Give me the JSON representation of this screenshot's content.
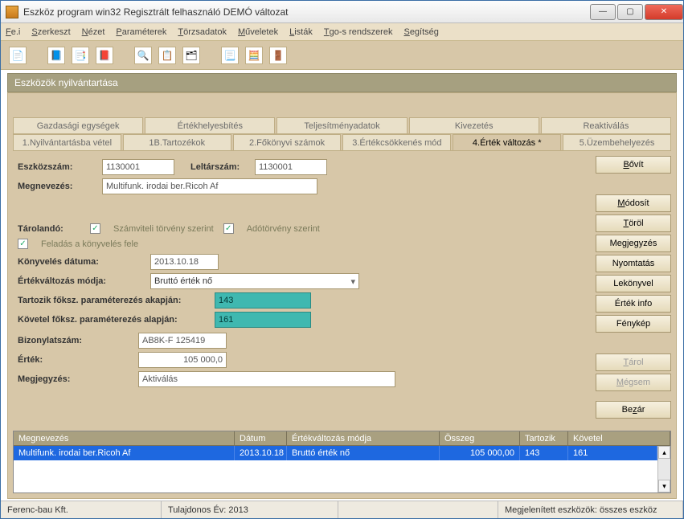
{
  "window": {
    "title": "Eszköz program win32 Regisztrált felhasználó  DEMÓ változat"
  },
  "menu": {
    "file": {
      "u": "F",
      "rest": "e.i"
    },
    "edit": {
      "u": "S",
      "rest": "zerkeszt"
    },
    "view": {
      "u": "N",
      "rest": "ézet"
    },
    "params": {
      "u": "P",
      "rest": "araméterek"
    },
    "torzs": {
      "u": "T",
      "rest": "örzsadatok"
    },
    "muv": {
      "u": "M",
      "rest": "űveletek"
    },
    "list": {
      "u": "L",
      "rest": "isták"
    },
    "tgo": {
      "u": "T",
      "rest": "go-s rendszerek"
    },
    "help": {
      "u": "S",
      "rest": "egítség"
    }
  },
  "panel_title": "Eszközök nyilvántartása",
  "tabs1": {
    "t0": "Gazdasági egységek",
    "t1": "Értékhelyesbítés",
    "t2": "Teljesítményadatok",
    "t3": "Kivezetés",
    "t4": "Reaktiválás"
  },
  "tabs2": {
    "t0": "1.Nyilvántartásba vétel",
    "t1": "1B.Tartozékok",
    "t2": "2.Főkönyvi számok",
    "t3": "3.Értékcsökkenés mód",
    "t4": "4.Érték változás *",
    "t5": "5.Üzembehelyezés"
  },
  "form": {
    "eszkozszam_lbl": "Eszközszám:",
    "eszkozszam_val": "1130001",
    "leltarszam_lbl": "Leltárszám:",
    "leltarszam_val": "1130001",
    "megnevezes_lbl": "Megnevezés:",
    "megnevezes_val": "Multifunk. irodai ber.Ricoh Af",
    "tarolando_lbl": "Tárolandó:",
    "cb_szamv": "Számviteli törvény szerint",
    "cb_ado": "Adótörvény szerint",
    "cb_feladas": "Feladás a könyvelés fele",
    "konyv_lbl": "Könyvelés dátuma:",
    "konyv_val": "2013.10.18",
    "ertekvalt_lbl": "Értékváltozás módja:",
    "ertekvalt_val": "Bruttó érték nő",
    "tartozik_lbl": "Tartozik főksz. paraméterezés akapján:",
    "tartozik_val": "143",
    "kovetel_lbl": "Követel főksz. paraméterezés alapján:",
    "kovetel_val": "161",
    "bizonylat_lbl": "Bizonylatszám:",
    "bizonylat_val": "AB8K-F 125419",
    "ertek_lbl": "Érték:",
    "ertek_val": "105 000,0",
    "megjegyzes_lbl": "Megjegyzés:",
    "megjegyzes_val": "Aktiválás"
  },
  "buttons": {
    "bovit": "<u>B</u>ővít",
    "modosit": "<u>M</u>ódosít",
    "torol": "<u>T</u>öröl",
    "megj": "Megjegyzés",
    "nyomt": "Nyomtatás",
    "lekonyv": "Lekönyvel",
    "einfo": "Érték info",
    "fenykep": "Fénykép",
    "tarol": "<u>T</u>árol",
    "megsem": "<u>M</u>égsem",
    "bezar": "Be<u>z</u>ár"
  },
  "buttons_plain": {
    "bovit": "Bővít",
    "modosit": "Módosít",
    "torol": "Töröl",
    "megj": "Megjegyzés",
    "nyomt": "Nyomtatás",
    "lekonyv": "Lekönyvel",
    "einfo": "Érték info",
    "fenykep": "Fénykép",
    "tarol": "Tárol",
    "megsem": "Mégsem",
    "bezar": "Bezár"
  },
  "table": {
    "headers": {
      "megnevezes": "Megnevezés",
      "datum": "Dátum",
      "mod": "Értékváltozás módja",
      "osszeg": "Összeg",
      "tartozik": "Tartozik",
      "kovetel": "Követel"
    },
    "row0": {
      "megnevezes": "Multifunk. irodai ber.Ricoh Af",
      "datum": "2013.10.18",
      "mod": "Bruttó érték nő",
      "osszeg": "105 000,00",
      "tartozik": "143",
      "kovetel": "161"
    }
  },
  "status": {
    "owner": "Ferenc-bau Kft.",
    "year": "Tulajdonos Év: 2013",
    "shown": "Megjelenített eszközök: összes eszköz"
  }
}
